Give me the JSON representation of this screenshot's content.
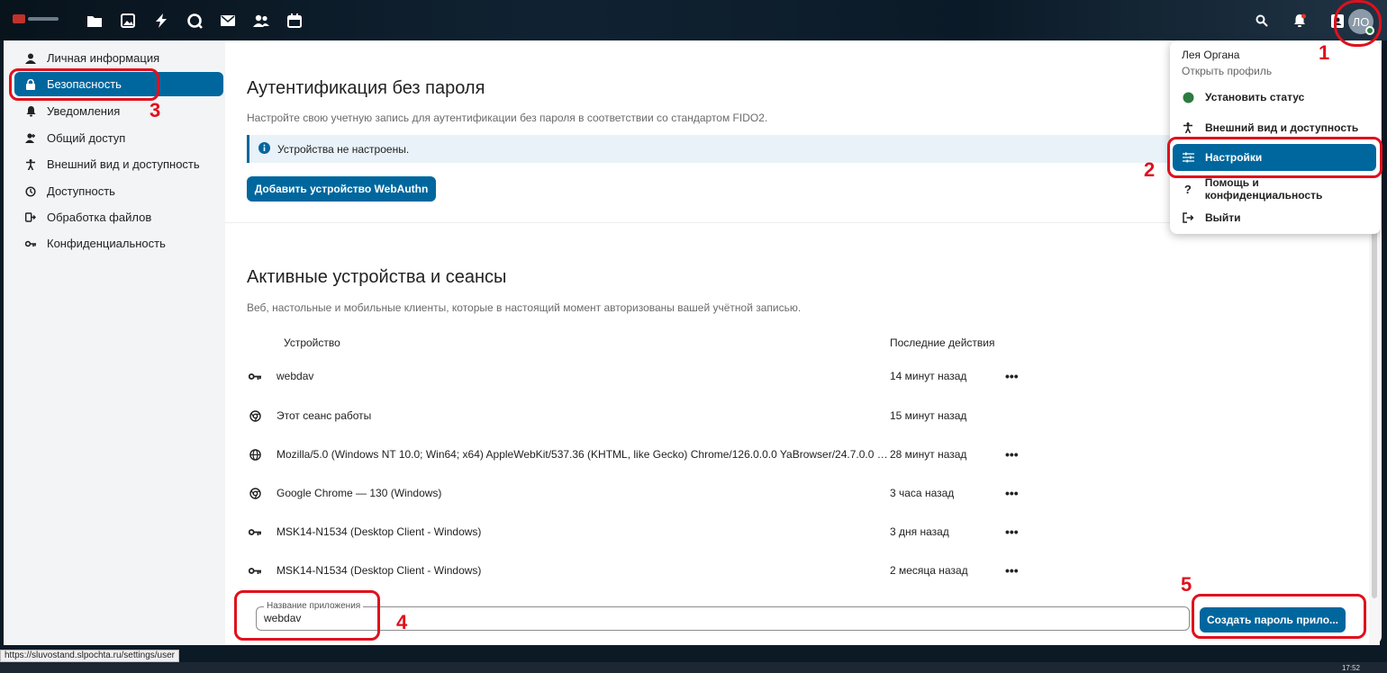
{
  "header": {
    "app_icons": [
      "files-icon",
      "photos-icon",
      "activity-icon",
      "talk-icon",
      "mail-icon",
      "contacts-icon",
      "calendar-icon"
    ],
    "avatar_initials": "ЛО"
  },
  "sidebar": {
    "items": [
      {
        "label": "Личная информация",
        "icon": "person-icon"
      },
      {
        "label": "Безопасность",
        "icon": "lock-icon"
      },
      {
        "label": "Уведомления",
        "icon": "bell-icon"
      },
      {
        "label": "Общий доступ",
        "icon": "share-icon"
      },
      {
        "label": "Внешний вид и доступность",
        "icon": "accessibility-icon"
      },
      {
        "label": "Доступность",
        "icon": "clock-icon"
      },
      {
        "label": "Обработка файлов",
        "icon": "file-flow-icon"
      },
      {
        "label": "Конфиденциальность",
        "icon": "key-icon"
      }
    ]
  },
  "passwordless": {
    "title": "Аутентификация без пароля",
    "description": "Настройте свою учетную запись для аутентификации без пароля в соответствии со стандартом FIDO2.",
    "notice": "Устройства не настроены.",
    "add_button": "Добавить устройство WebAuthn"
  },
  "sessions": {
    "title": "Активные устройства и сеансы",
    "description": "Веб, настольные и мобильные клиенты, которые в настоящий момент авторизованы вашей учётной записью.",
    "col_device": "Устройство",
    "col_activity": "Последние действия",
    "rows": [
      {
        "icon": "key-icon",
        "name": "webdav",
        "activity": "14 минут назад",
        "menu": "•••"
      },
      {
        "icon": "browser-icon",
        "name": "Этот сеанс работы",
        "activity": "15 минут назад",
        "menu": ""
      },
      {
        "icon": "globe-icon",
        "name": "Mozilla/5.0 (Windows NT 10.0; Win64; x64) AppleWebKit/537.36 (KHTML, like Gecko) Chrome/126.0.0.0 YaBrowser/24.7.0.0 Saf...",
        "activity": "28 минут назад",
        "menu": "•••"
      },
      {
        "icon": "chrome-icon",
        "name": "Google Chrome — 130 (Windows)",
        "activity": "3 часа назад",
        "menu": "•••"
      },
      {
        "icon": "key-icon",
        "name": "MSK14-N1534 (Desktop Client - Windows)",
        "activity": "3 дня назад",
        "menu": "•••"
      },
      {
        "icon": "key-icon",
        "name": "MSK14-N1534 (Desktop Client - Windows)",
        "activity": "2 месяца назад",
        "menu": "•••"
      }
    ],
    "app_name_label": "Название приложения",
    "app_name_value": "webdav",
    "create_button": "Создать пароль прило..."
  },
  "user_menu": {
    "name": "Лея Органа",
    "profile_link": "Открыть профиль",
    "items": [
      {
        "label": "Установить статус",
        "icon": "status-dot-icon"
      },
      {
        "label": "Внешний вид и доступность",
        "icon": "accessibility-icon"
      },
      {
        "label": "Настройки",
        "icon": "sliders-icon"
      },
      {
        "label": "Помощь и конфиденциальность",
        "icon": "help-icon"
      },
      {
        "label": "Выйти",
        "icon": "logout-icon"
      }
    ]
  },
  "annotations": [
    "1",
    "2",
    "3",
    "4",
    "5"
  ],
  "status_url": "https://sluvostand.slpochta.ru/settings/user",
  "clock": "17:52",
  "colors": {
    "accent": "#00679e",
    "annotation": "#e0101c",
    "online": "#2d7b41"
  }
}
